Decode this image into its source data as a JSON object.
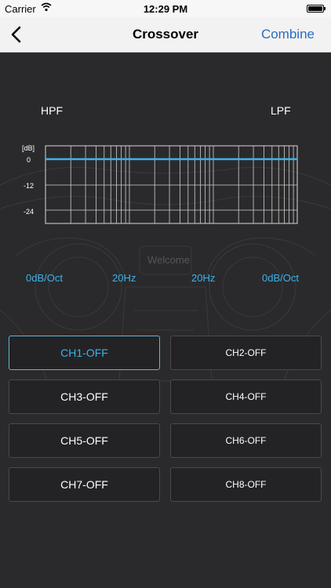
{
  "status_bar": {
    "carrier": "Carrier",
    "time": "12:29 PM",
    "battery_level": 1.0
  },
  "nav": {
    "title": "Crossover",
    "right_action": "Combine"
  },
  "labels": {
    "hpf": "HPF",
    "lpf": "LPF"
  },
  "graph": {
    "unit_label": "[dB]",
    "y_ticks": [
      "0",
      "-12",
      "-24"
    ],
    "line_color": "#3db3e8"
  },
  "watermark": "Welcome",
  "params": {
    "hpf_slope": "0dB/Oct",
    "hpf_freq": "20Hz",
    "lpf_freq": "20Hz",
    "lpf_slope": "0dB/Oct"
  },
  "channels": [
    {
      "label": "CH1-OFF",
      "active": true
    },
    {
      "label": "CH2-OFF",
      "active": false
    },
    {
      "label": "CH3-OFF",
      "active": false
    },
    {
      "label": "CH4-OFF",
      "active": false
    },
    {
      "label": "CH5-OFF",
      "active": false
    },
    {
      "label": "CH6-OFF",
      "active": false
    },
    {
      "label": "CH7-OFF",
      "active": false
    },
    {
      "label": "CH8-OFF",
      "active": false
    }
  ],
  "colors": {
    "accent": "#3db3e8",
    "nav_link": "#2b6dbf",
    "background": "#2a2a2c"
  }
}
